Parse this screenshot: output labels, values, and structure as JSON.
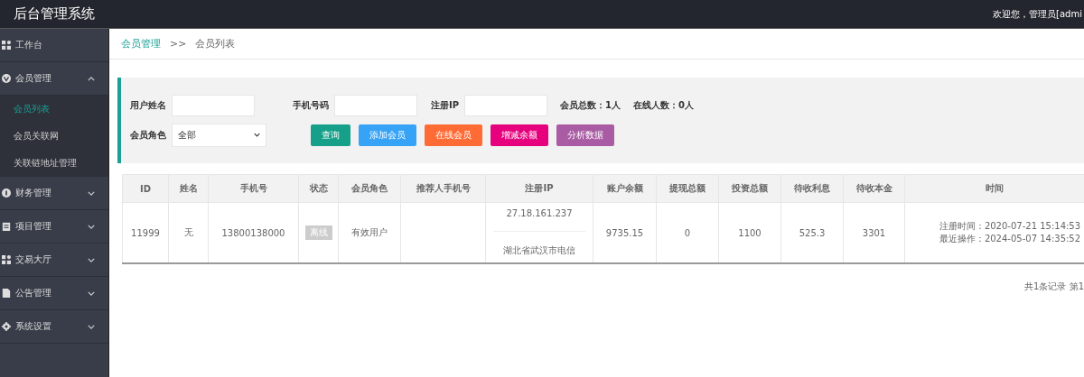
{
  "header": {
    "title": "后台管理系统",
    "welcome": "欢迎您，管理员[admi"
  },
  "sidebar": {
    "items": [
      {
        "label": "工作台"
      },
      {
        "label": "会员管理",
        "expanded": true,
        "children": [
          {
            "label": "会员列表",
            "selected": true
          },
          {
            "label": "会员关联网",
            "selected": false
          },
          {
            "label": "关联链地址管理",
            "selected": false
          }
        ]
      },
      {
        "label": "财务管理",
        "expanded": false
      },
      {
        "label": "项目管理",
        "expanded": false
      },
      {
        "label": "交易大厅",
        "expanded": false
      },
      {
        "label": "公告管理",
        "expanded": false
      },
      {
        "label": "系统设置",
        "expanded": false
      }
    ]
  },
  "breadcrumb": {
    "parent": "会员管理",
    "separator": ">>",
    "current": "会员列表"
  },
  "search": {
    "fields": [
      {
        "label": "用户姓名"
      },
      {
        "label": "手机号码"
      },
      {
        "label": "注册IP"
      }
    ],
    "stats": [
      "会员总数：1人",
      "在线人数：0人"
    ],
    "role": {
      "label": "会员角色",
      "value": "全部"
    },
    "buttons": [
      {
        "label": "查询",
        "color": "#16a08a"
      },
      {
        "label": "添加会员",
        "color": "#36a3f7"
      },
      {
        "label": "在线会员",
        "color": "#ff6b35"
      },
      {
        "label": "增减余额",
        "color": "#e6007e"
      },
      {
        "label": "分析数据",
        "color": "#a95ba3"
      }
    ]
  },
  "table": {
    "columns": [
      "ID",
      "姓名",
      "手机号",
      "状态",
      "会员角色",
      "推荐人手机号",
      "注册IP",
      "账户余额",
      "提现总额",
      "投资总额",
      "待收利息",
      "待收本金",
      "时间"
    ],
    "rows": [
      {
        "id": "11999",
        "name": "无",
        "phone": "13800138000",
        "status": "离线",
        "online": false,
        "role": "有效用户",
        "ip": "27.18.161.237",
        "ip_location": "湖北省武汉市电信",
        "balance": "9735.15",
        "withdrawn": "0",
        "invested": "1100",
        "pending_interest": "525.3",
        "pending_principal": "3301",
        "registered": "注册时间：2020-07-21 15:14:53",
        "last_action": "最近操作：2024-05-07 14:35:52"
      }
    ]
  },
  "pagination": "共1条记录 第1"
}
